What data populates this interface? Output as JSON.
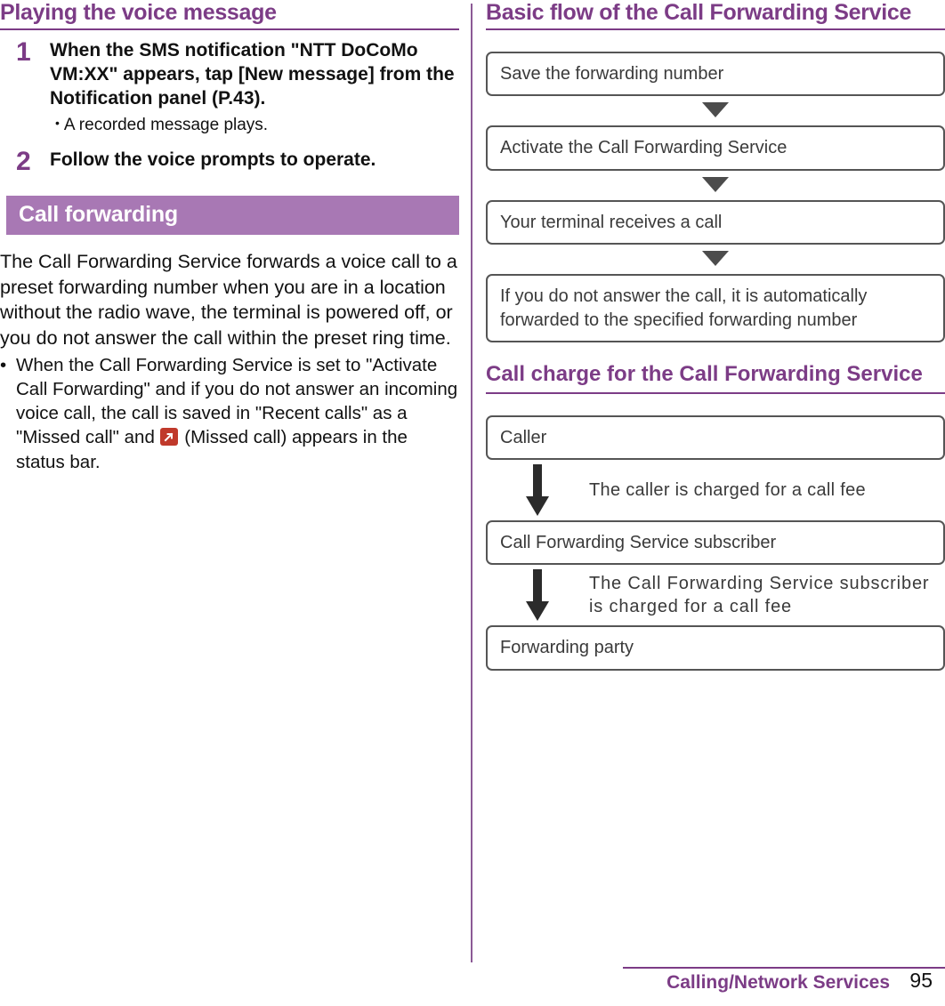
{
  "left": {
    "heading": "Playing the voice message",
    "steps": [
      {
        "num": "1",
        "title": "When the SMS notification \"NTT DoCoMo VM:XX\" appears, tap [New message] from the Notification panel (P.43).",
        "bullet": "A recorded message plays."
      },
      {
        "num": "2",
        "title": "Follow the voice prompts to operate.",
        "bullet": ""
      }
    ],
    "band_title": "Call forwarding",
    "paragraph": "The Call Forwarding Service forwards a voice call to a preset forwarding number when you are in a location without the radio wave, the terminal is powered off, or you do not answer the call within the preset ring time.",
    "bullet_pre": "When the Call Forwarding Service is set to \"Activate Call Forwarding\" and if you do not answer an incoming voice call, the call is saved in \"Recent calls\" as a \"Missed call\" and ",
    "bullet_post": " (Missed call) appears in the status bar.",
    "bullet_dot": "•",
    "missed_call_icon": "missed-call-icon"
  },
  "right": {
    "heading": "Basic flow of the Call Forwarding Service",
    "flow": [
      "Save the forwarding number",
      "Activate the Call Forwarding Service",
      "Your terminal receives a call",
      "If you do not answer the call, it is automatically forwarded to the specified forwarding number"
    ],
    "charge_heading": "Call charge for the Call Forwarding Service",
    "charge": {
      "box1": "Caller",
      "note1": "The caller is charged for a call fee",
      "box2": "Call Forwarding Service subscriber",
      "note2": "The Call Forwarding Service subscriber is charged for a call fee",
      "box3": "Forwarding party"
    }
  },
  "footer": {
    "section": "Calling/Network Services",
    "page": "95"
  },
  "colors": {
    "accent": "#7c3c86",
    "band": "#a878b4",
    "box_border": "#555555",
    "icon_red": "#c0392b"
  }
}
